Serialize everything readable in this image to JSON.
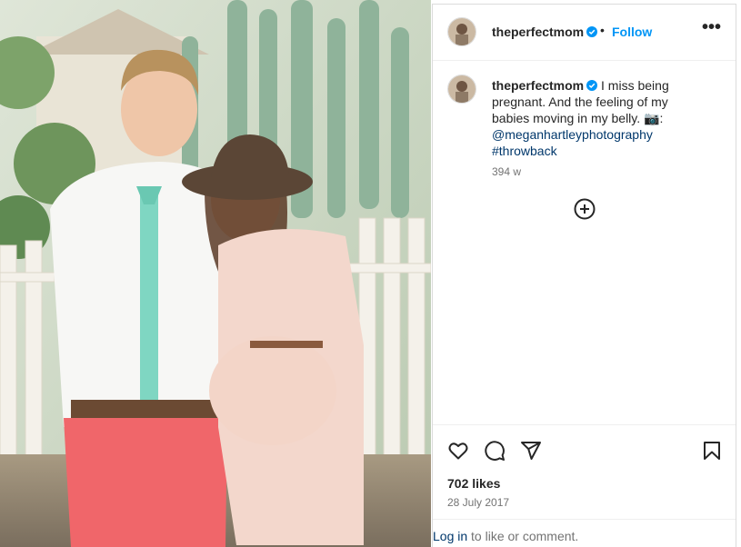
{
  "post": {
    "username": "theperfectmom",
    "follow_label": "Follow",
    "separator": "•",
    "more_label": "•••",
    "caption": {
      "text": "I miss being pregnant. And the feeling of my babies moving in my belly. 📷:",
      "mention": "@meganhartleyphotography",
      "hashtag": "#throwback"
    },
    "time_ago": "394 w",
    "likes": "702 likes",
    "date": "28 July 2017",
    "login_link": "Log in",
    "login_suffix": " to like or comment."
  },
  "icons": [
    "verified-badge-icon",
    "heart-icon",
    "comment-icon",
    "share-icon",
    "save-icon",
    "add-circle-icon",
    "more-options-icon"
  ],
  "colors": {
    "link_blue": "#0095f6",
    "link_dark": "#00376b",
    "muted": "#737373",
    "text": "#262626"
  }
}
